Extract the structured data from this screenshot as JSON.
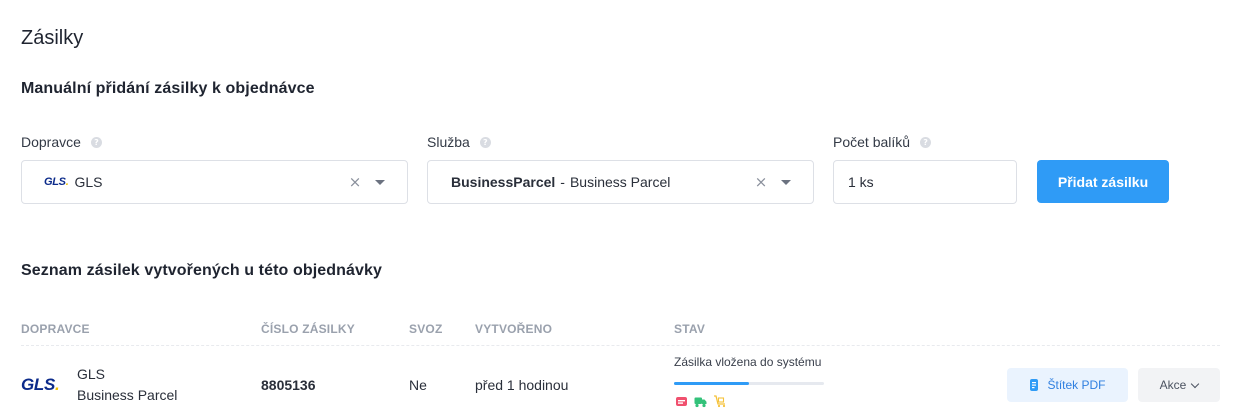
{
  "page": {
    "title": "Zásilky"
  },
  "manual": {
    "title": "Manuální přidání zásilky k objednávce",
    "carrier": {
      "label": "Dopravce",
      "logo_text": "GLS",
      "value": "GLS"
    },
    "service": {
      "label": "Služba",
      "code": "BusinessParcel",
      "separator": "-",
      "name": "Business Parcel"
    },
    "count": {
      "label": "Počet balíků",
      "value": "1 ks"
    },
    "help_glyph": "?",
    "clear_glyph": "×",
    "add_button_label": "Přidat zásilku"
  },
  "list": {
    "title": "Seznam zásilek vytvořených u této objednávky",
    "columns": [
      "DOPRAVCE",
      "ČÍSLO ZÁSILKY",
      "SVOZ",
      "VYTVOŘENO",
      "STAV"
    ],
    "rows": [
      {
        "carrier_logo": "GLS",
        "carrier": "GLS",
        "service": "Business Parcel",
        "number": "8805136",
        "pickup": "Ne",
        "created": "před 1 hodinou",
        "status": "Zásilka vložena do systému",
        "progress": 0.5,
        "step_icons": [
          "package-icon",
          "truck-icon",
          "delivered-icon"
        ],
        "label_button": "Štítek PDF",
        "actions_button": "Akce"
      }
    ]
  },
  "colors": {
    "accent": "#2f9bf6",
    "gls_blue": "#0b2a8a",
    "gls_yellow": "#f2c200",
    "step_red": "#f0506e",
    "step_green": "#33c27a",
    "step_yellow": "#f5c23b"
  }
}
